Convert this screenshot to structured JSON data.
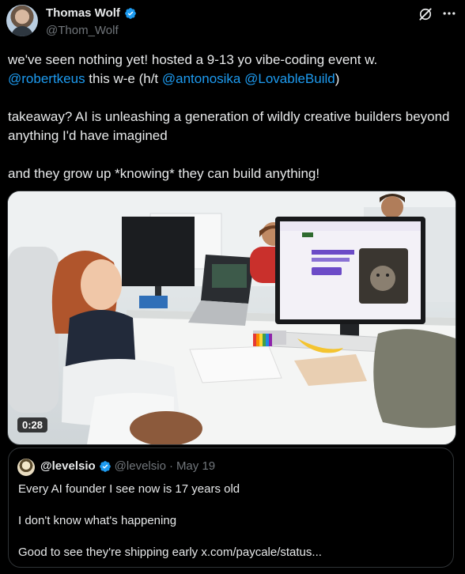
{
  "author": {
    "display_name": "Thomas Wolf",
    "handle": "@Thom_Wolf"
  },
  "tweet": {
    "line1": "we've seen nothing yet! hosted a 9-13 yo vibe-coding event w.",
    "mention_robertkeus": "@robertkeus",
    "text_mid": " this w-e (h/t ",
    "mention_antonosika": "@antonosika",
    "mention_lovable": "@LovableBuild",
    "text_close": ")",
    "paragraph2": "takeaway? AI is unleashing a generation of wildly creative builders beyond anything I'd have imagined",
    "paragraph3": "and they grow up *knowing* they can build anything!"
  },
  "media": {
    "duration": "0:28",
    "screen_text": "Vind je perfecte kattenvriendje"
  },
  "quote": {
    "display_name": "@levelsio",
    "handle": "@levelsio",
    "separator": "·",
    "date": "May 19",
    "line1": "Every AI founder I see now is 17 years old",
    "line2": "I don't know what's happening",
    "line3": "Good to see they're shipping early x.com/paycale/status..."
  },
  "icons": {
    "verified": "verified-badge-icon",
    "grok": "grok-icon",
    "more": "more-icon"
  },
  "colors": {
    "background": "#000000",
    "text": "#e7e9ea",
    "secondary": "#71767b",
    "link": "#1d9bf0",
    "border": "#2f3336"
  }
}
